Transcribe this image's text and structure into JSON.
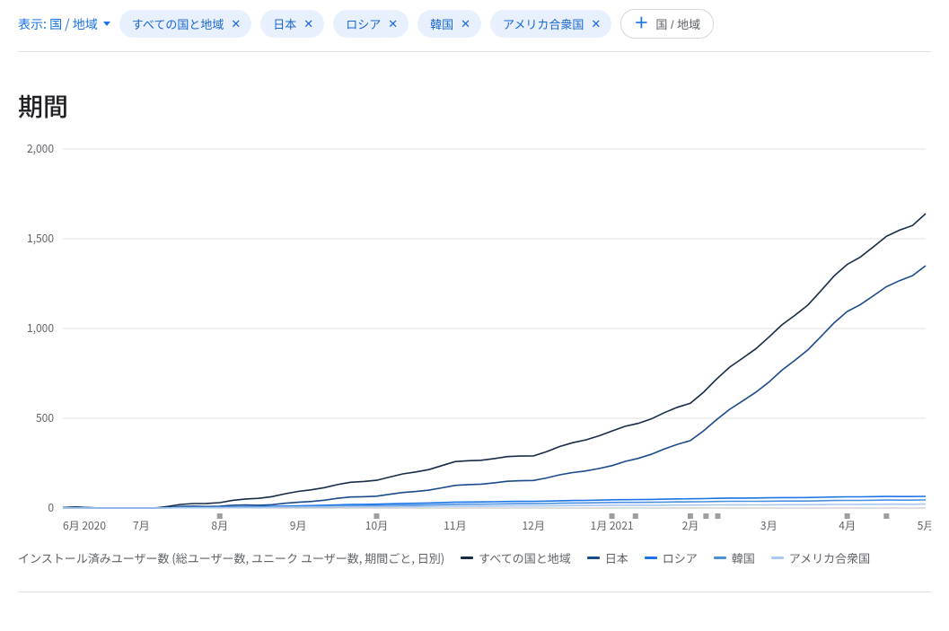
{
  "filter": {
    "label": "表示: 国 / 地域",
    "chips": [
      "すべての国と地域",
      "日本",
      "ロシア",
      "韓国",
      "アメリカ合衆国"
    ],
    "add_label": "国 / 地域"
  },
  "title": "期間",
  "legend": {
    "prefix": "インストール済みユーザー数 (総ユーザー数, ユニーク ユーザー数, 期間ごと, 日別)",
    "items": [
      {
        "name": "すべての国と地域",
        "color": "#172b47"
      },
      {
        "name": "日本",
        "color": "#1a4a8a"
      },
      {
        "name": "ロシア",
        "color": "#1a73e8"
      },
      {
        "name": "韓国",
        "color": "#4a90e2"
      },
      {
        "name": "アメリカ合衆国",
        "color": "#a8c8f0"
      }
    ]
  },
  "chart_data": {
    "type": "line",
    "title": "期間",
    "ylabel": "",
    "xlabel": "",
    "ylim": [
      0,
      2000
    ],
    "yticks": [
      0,
      500,
      1000,
      1500,
      2000
    ],
    "categories": [
      "6月 2020",
      "7月",
      "8月",
      "9月",
      "10月",
      "11月",
      "12月",
      "1月 2021",
      "2月",
      "3月",
      "4月",
      "5月"
    ],
    "series": [
      {
        "name": "すべての国と地域",
        "color": "#172b47",
        "values": [
          0,
          0,
          30,
          90,
          160,
          250,
          300,
          420,
          590,
          950,
          1350,
          1640
        ]
      },
      {
        "name": "日本",
        "color": "#1a4a8a",
        "values": [
          0,
          0,
          10,
          30,
          70,
          120,
          160,
          230,
          380,
          700,
          1090,
          1350
        ]
      },
      {
        "name": "ロシア",
        "color": "#1a73e8",
        "values": [
          0,
          0,
          5,
          12,
          22,
          32,
          38,
          45,
          52,
          57,
          62,
          65
        ]
      },
      {
        "name": "韓国",
        "color": "#4a90e2",
        "values": [
          0,
          0,
          3,
          8,
          14,
          20,
          25,
          30,
          35,
          38,
          42,
          45
        ]
      },
      {
        "name": "アメリカ合衆国",
        "color": "#a8c8f0",
        "values": [
          0,
          0,
          2,
          5,
          8,
          10,
          12,
          15,
          17,
          18,
          20,
          22
        ]
      }
    ],
    "markers_x": [
      2.0,
      4.0,
      7.0,
      7.3,
      8.0,
      8.2,
      8.35,
      10.0,
      10.5
    ]
  }
}
